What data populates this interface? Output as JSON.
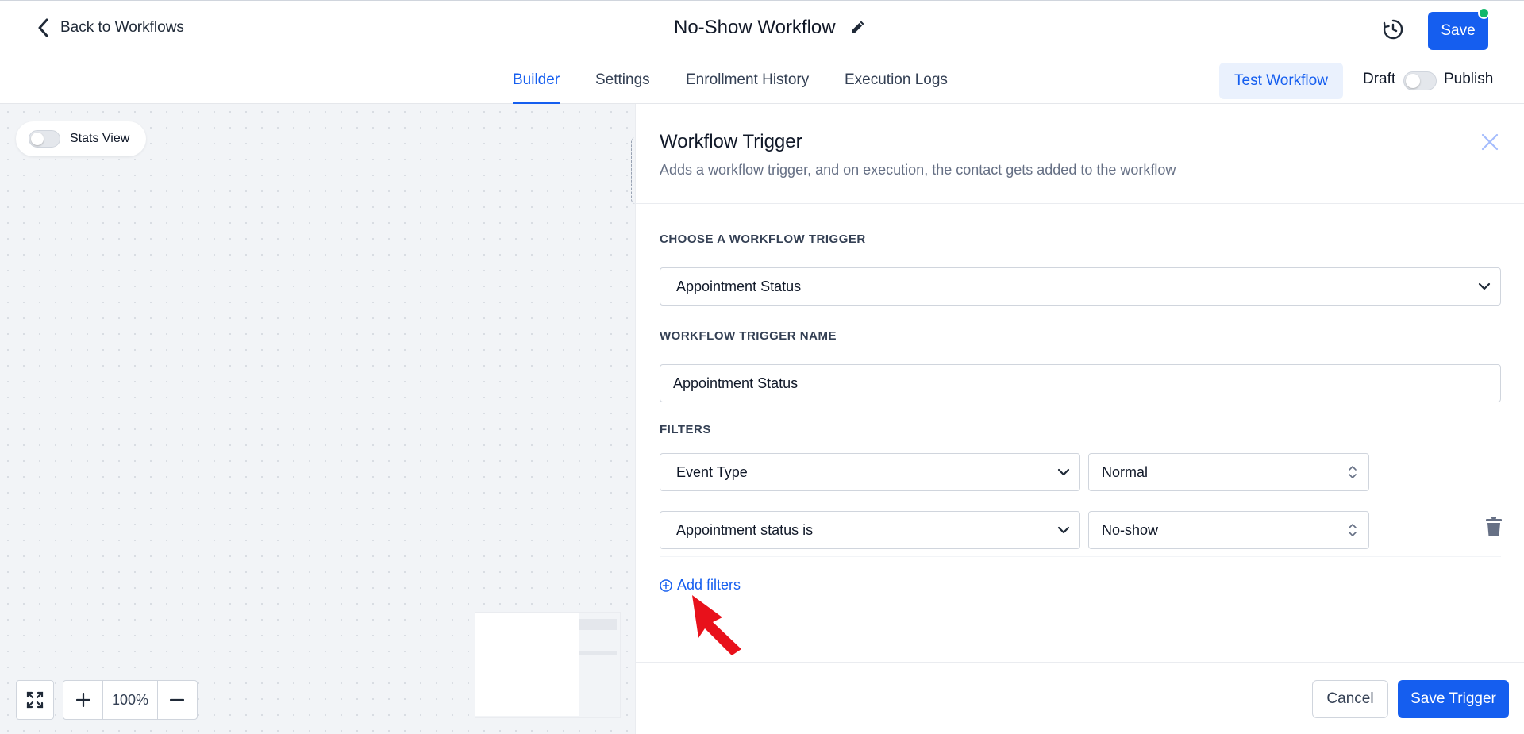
{
  "header": {
    "back_label": "Back to Workflows",
    "title": "No-Show Workflow",
    "save_label": "Save",
    "icons": {
      "back": "chevron-left-icon",
      "edit": "pencil-icon",
      "history": "history-clock-icon"
    }
  },
  "tabs": [
    {
      "label": "Builder",
      "active": true
    },
    {
      "label": "Settings",
      "active": false
    },
    {
      "label": "Enrollment History",
      "active": false
    },
    {
      "label": "Execution Logs",
      "active": false
    }
  ],
  "actions": {
    "test_workflow_label": "Test Workflow",
    "draft_label": "Draft",
    "publish_label": "Publish",
    "publish_toggle_on": false
  },
  "canvas": {
    "stats_view_label": "Stats View",
    "stats_view_on": false,
    "zoom": "100%"
  },
  "panel": {
    "title": "Workflow Trigger",
    "subtitle": "Adds a workflow trigger, and on execution, the contact gets added to the workflow",
    "choose_trigger_label": "CHOOSE A WORKFLOW TRIGGER",
    "selected_trigger": "Appointment Status",
    "trigger_name_label": "WORKFLOW TRIGGER NAME",
    "trigger_name_value": "Appointment Status",
    "filters_label": "FILTERS",
    "filters": [
      {
        "field": "Event Type",
        "value": "Normal"
      },
      {
        "field": "Appointment status is",
        "value": "No-show"
      }
    ],
    "add_filters_label": "Add filters",
    "cancel_label": "Cancel",
    "save_trigger_label": "Save Trigger"
  },
  "colors": {
    "primary": "#155eef",
    "annotation_arrow": "#e8111b",
    "status_dot": "#12b76a"
  }
}
